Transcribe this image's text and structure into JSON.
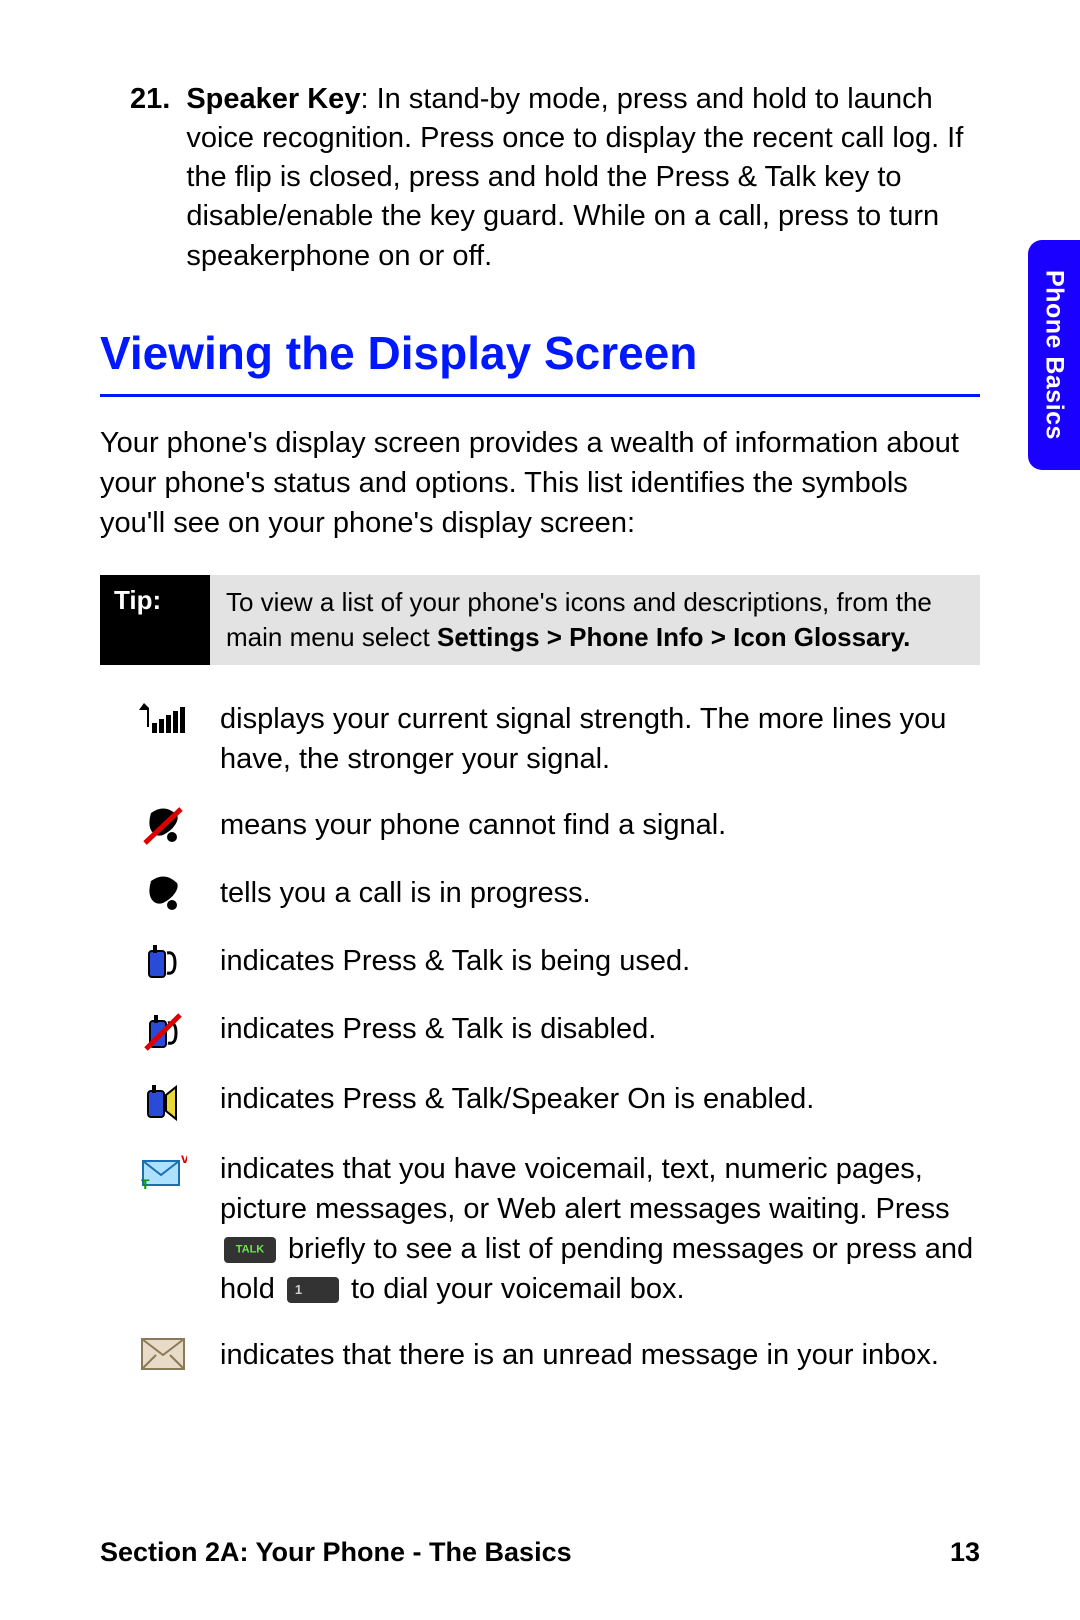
{
  "sideTab": "Phone Basics",
  "item21": {
    "num": "21.",
    "label": "Speaker Key",
    "text": ": In stand-by mode, press and hold to launch voice recognition. Press once to display the recent call log. If the flip is closed, press and hold  the Press & Talk key to disable/enable the key guard. While on a call, press to turn speakerphone on or off."
  },
  "heading": "Viewing the Display Screen",
  "intro": "Your phone's display screen provides a wealth of information about your phone's status and options. This list identifies the symbols you'll see on your phone's display screen:",
  "tip": {
    "label": "Tip:",
    "text": "To view a list of your phone's icons and descriptions, from the main menu select ",
    "bold": "Settings > Phone Info > Icon Glossary."
  },
  "rows": {
    "signal": "displays your current signal strength. The more lines you have, the stronger your signal.",
    "nosignal": "means your phone cannot find a signal.",
    "call": "tells you a call is in progress.",
    "ptt": "indicates Press & Talk is being used.",
    "pttDisabled": "indicates Press & Talk is disabled.",
    "pttSpeaker": "indicates Press & Talk/Speaker On is enabled.",
    "msg_a": "indicates that you have voicemail, text, numeric pages, picture messages, or Web alert messages waiting. Press ",
    "msg_b": " briefly to see a list of pending messages or press and hold ",
    "msg_c": " to dial your voicemail box.",
    "unread": "indicates that there is an unread message in your inbox."
  },
  "footer": {
    "section": "Section 2A: Your Phone - The Basics",
    "page": "13"
  }
}
